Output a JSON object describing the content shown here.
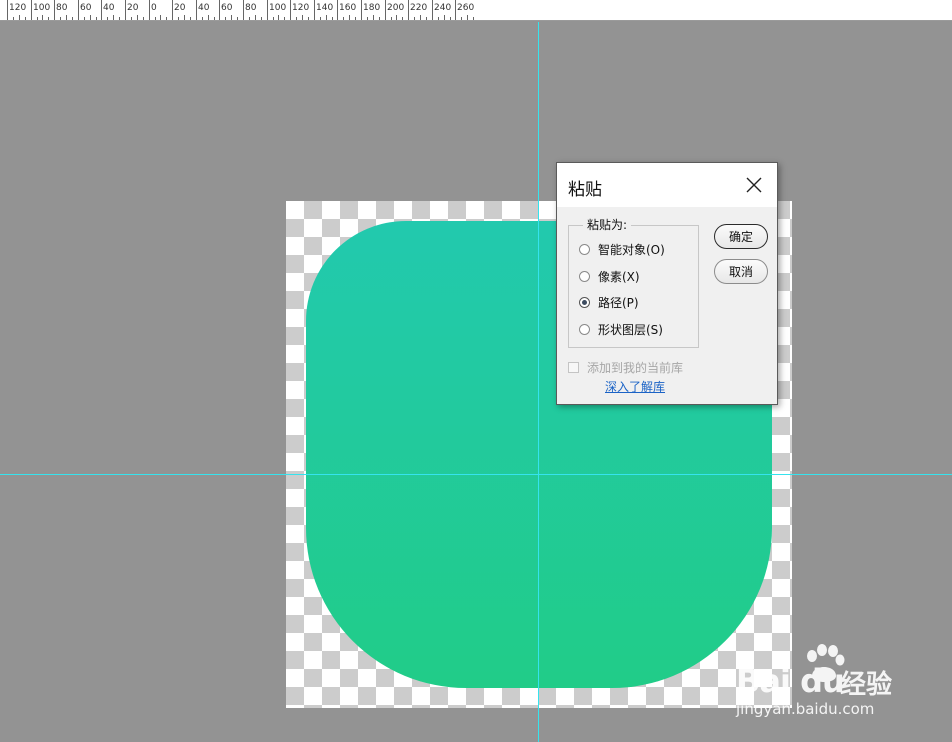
{
  "ruler": {
    "labels": [
      "120",
      "100",
      "80",
      "60",
      "40",
      "20",
      "0",
      "20",
      "40",
      "60",
      "80",
      "100",
      "120",
      "140",
      "160",
      "180",
      "200",
      "220",
      "240",
      "260"
    ]
  },
  "dialog": {
    "title": "粘贴",
    "group_label": "粘贴为:",
    "options": [
      {
        "label": "智能对象(O)",
        "selected": false
      },
      {
        "label": "像素(X)",
        "selected": false
      },
      {
        "label": "路径(P)",
        "selected": true
      },
      {
        "label": "形状图层(S)",
        "selected": false
      }
    ],
    "ok_label": "确定",
    "cancel_label": "取消",
    "checkbox_label": "添加到我的当前库",
    "checkbox_checked": false,
    "checkbox_enabled": false,
    "link_label": "深入了解库"
  },
  "watermark": {
    "logo_text": "Bai du",
    "cn_text": "经验",
    "url": "jingyan.baidu.com"
  },
  "colors": {
    "background": "#939393",
    "guide": "#35e3ee",
    "shape_top": "#22c9ae",
    "shape_bottom": "#21cc88",
    "link": "#1b63c6"
  }
}
